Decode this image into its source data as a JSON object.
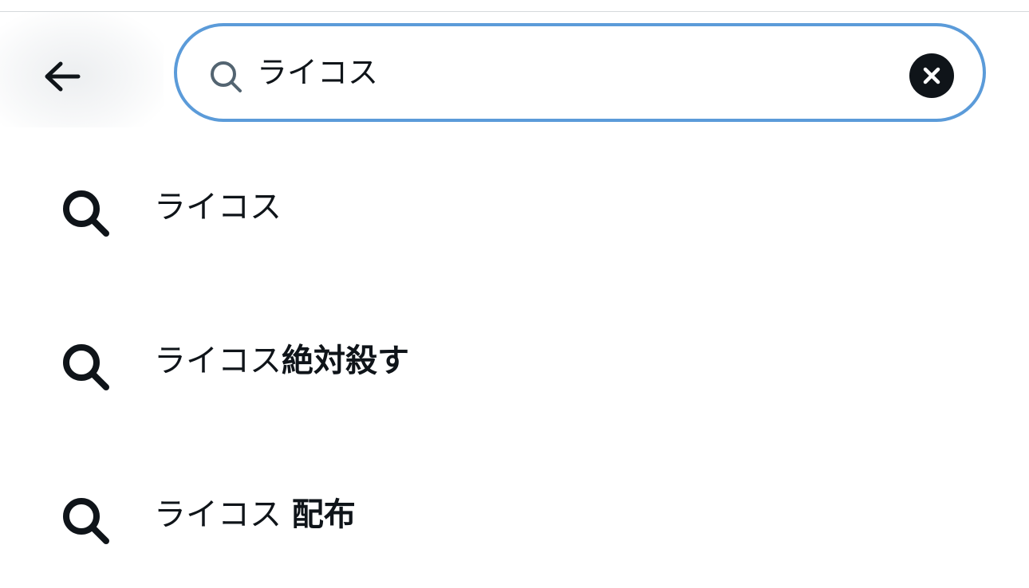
{
  "header": {
    "back_icon": "arrow-left-icon",
    "search": {
      "icon": "search-icon",
      "value": "ライコス",
      "placeholder": "",
      "clear_icon": "close-icon",
      "border_color": "#5b9bd9"
    }
  },
  "suggestions": [
    {
      "icon": "search-icon",
      "query": "ライコス",
      "completion": ""
    },
    {
      "icon": "search-icon",
      "query": "ライコス",
      "completion": "絶対殺す"
    },
    {
      "icon": "search-icon",
      "query": "ライコス ",
      "completion": "配布"
    }
  ],
  "colors": {
    "text": "#0f1419",
    "accent_border": "#5b9bd9",
    "divider": "#d6d9dc"
  }
}
